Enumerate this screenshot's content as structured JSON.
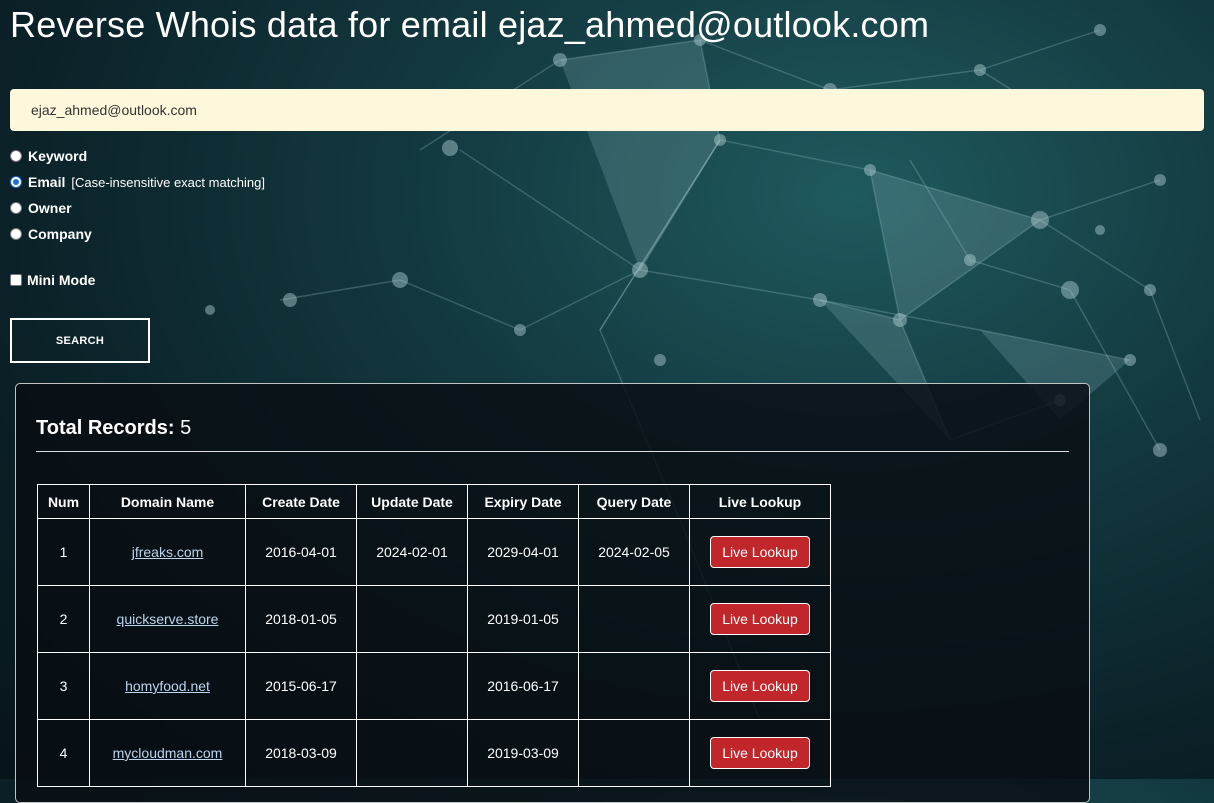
{
  "page": {
    "title": "Reverse Whois data for email ejaz_ahmed@outlook.com"
  },
  "search": {
    "value": "ejaz_ahmed@outlook.com"
  },
  "options": [
    {
      "label": "Keyword",
      "checked": false,
      "note": ""
    },
    {
      "label": "Email",
      "checked": true,
      "note": "[Case-insensitive exact matching]"
    },
    {
      "label": "Owner",
      "checked": false,
      "note": ""
    },
    {
      "label": "Company",
      "checked": false,
      "note": ""
    }
  ],
  "mini_mode": {
    "label": "Mini Mode",
    "checked": false
  },
  "search_button": {
    "label": "SEARCH"
  },
  "results": {
    "total_label": "Total Records:",
    "total_value": "5",
    "columns": [
      "Num",
      "Domain Name",
      "Create Date",
      "Update Date",
      "Expiry Date",
      "Query Date",
      "Live Lookup"
    ],
    "rows": [
      {
        "num": "1",
        "domain": "jfreaks.com",
        "create": "2016-04-01",
        "update": "2024-02-01",
        "expiry": "2029-04-01",
        "query": "2024-02-05",
        "action": "Live Lookup"
      },
      {
        "num": "2",
        "domain": "quickserve.store",
        "create": "2018-01-05",
        "update": "",
        "expiry": "2019-01-05",
        "query": "",
        "action": "Live Lookup"
      },
      {
        "num": "3",
        "domain": "homyfood.net",
        "create": "2015-06-17",
        "update": "",
        "expiry": "2016-06-17",
        "query": "",
        "action": "Live Lookup"
      },
      {
        "num": "4",
        "domain": "mycloudman.com",
        "create": "2018-03-09",
        "update": "",
        "expiry": "2019-03-09",
        "query": "",
        "action": "Live Lookup"
      }
    ]
  }
}
